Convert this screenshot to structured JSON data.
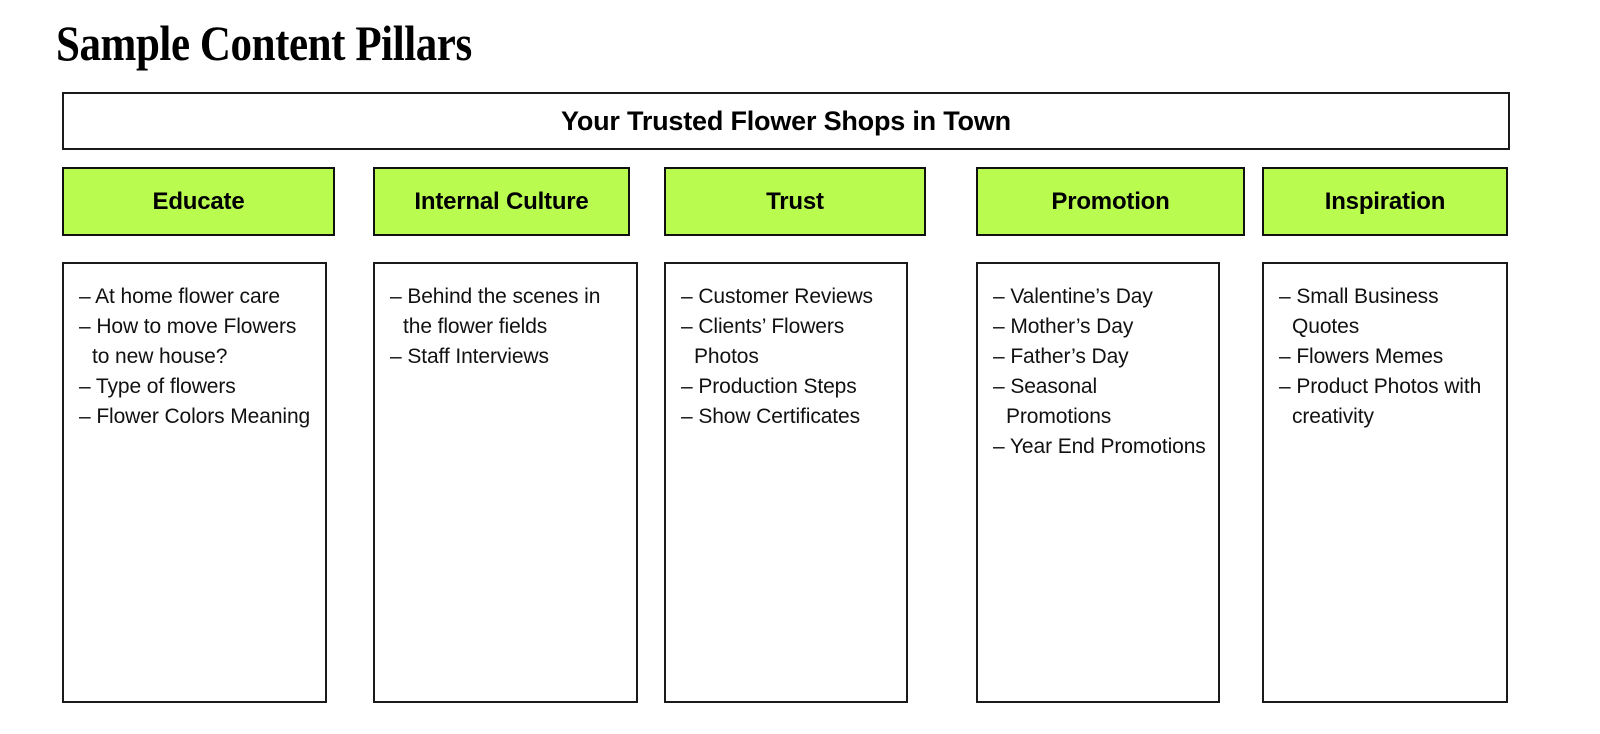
{
  "page": {
    "title": "Sample Content Pillars",
    "accent_color": "#BAFB50",
    "border_color": "#1a1a1a",
    "background_color": "#ffffff",
    "text_color": "#000000"
  },
  "banner": {
    "text": "Your Trusted Flower Shops in Town"
  },
  "pillars": [
    {
      "label": "Educate",
      "items": [
        "– At home flower care",
        "– How to move Flowers to new house?",
        "– Type of flowers",
        "– Flower Colors Meaning"
      ]
    },
    {
      "label": "Internal Culture",
      "items": [
        "– Behind the scenes in the flower fields",
        "– Staff Interviews"
      ]
    },
    {
      "label": "Trust",
      "items": [
        "– Customer Reviews",
        "– Clients’ Flowers Photos",
        "– Production Steps",
        "– Show Certificates"
      ]
    },
    {
      "label": "Promotion",
      "items": [
        "– Valentine’s Day",
        "– Mother’s Day",
        "– Father’s Day",
        "– Seasonal Promotions",
        "– Year End Promotions"
      ]
    },
    {
      "label": "Inspiration",
      "items": [
        "– Small Business Quotes",
        "– Flowers Memes",
        "– Product Photos with creativity"
      ]
    }
  ]
}
